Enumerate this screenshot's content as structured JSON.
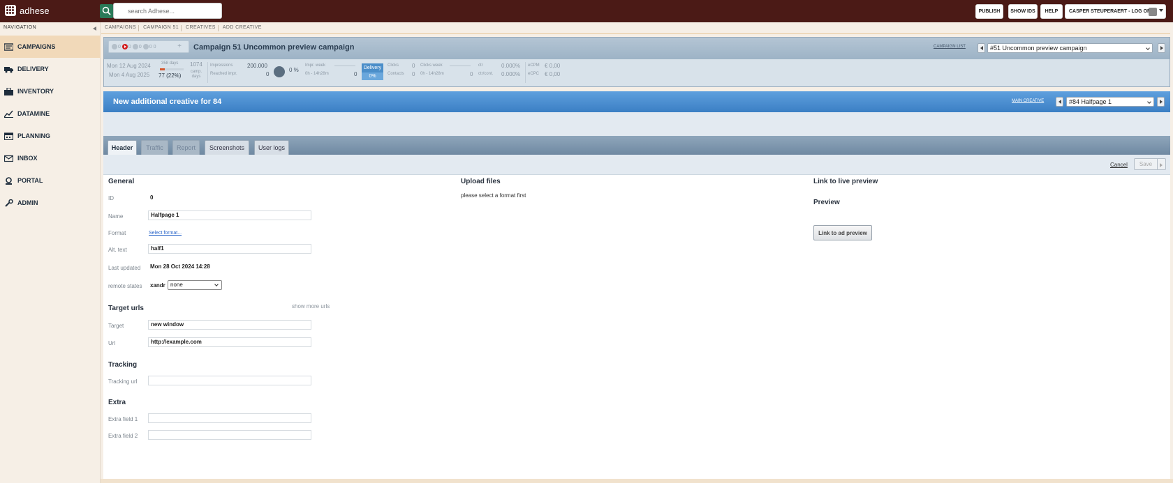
{
  "app": {
    "logo_text": "adhese"
  },
  "search": {
    "placeholder": "search Adhese..."
  },
  "topbar": {
    "publish": "PUBLISH",
    "show_ids": "SHOW IDS",
    "help": "HELP",
    "user": "CASPER STEUPERAERT - LOG OFF"
  },
  "sidebar": {
    "title": "NAVIGATION",
    "items": [
      {
        "label": "CAMPAIGNS",
        "icon": "campaigns-icon",
        "active": true
      },
      {
        "label": "DELIVERY",
        "icon": "truck-icon"
      },
      {
        "label": "INVENTORY",
        "icon": "briefcase-icon"
      },
      {
        "label": "DATAMINE",
        "icon": "chart-line-icon"
      },
      {
        "label": "PLANNING",
        "icon": "calendar-icon"
      },
      {
        "label": "INBOX",
        "icon": "envelope-icon"
      },
      {
        "label": "PORTAL",
        "icon": "portal-icon"
      },
      {
        "label": "ADMIN",
        "icon": "wrench-icon"
      }
    ]
  },
  "breadcrumb": [
    "CAMPAIGNS",
    "CAMPAIGN 51",
    "CREATIVES",
    "ADD CREATIVE"
  ],
  "campaign": {
    "status_counts": [
      "0",
      "0",
      "0",
      "0",
      "0"
    ],
    "title": "Campaign 51   Uncommon preview campaign",
    "list_link": "CAMPAIGN LIST",
    "select_value": "#51 Uncommon preview campaign",
    "start_date": "Mon 12 Aug 2024",
    "end_date": "Mon 4 Aug 2025",
    "days_total": "358 days",
    "days_done": "77 (22%)",
    "days_progress": 0.22,
    "camp_days_value": "1074",
    "camp_days_label": "camp. days",
    "impressions_label": "Impressions",
    "impressions_value": "200.000",
    "reached_label": "Reached impr.",
    "reached_value": "0",
    "gauge_pct": "0 %",
    "impr_week_label": "Impr. week",
    "impr_week_range": "0h - 14h28m",
    "impr_week_value": "0",
    "delivery_label": "Delivery",
    "delivery_pct": "0%",
    "clicks_label": "Clicks",
    "clicks_value": "0",
    "contacts_label": "Contacts",
    "contacts_value": "0",
    "clicks_week_label": "Clicks week",
    "clicks_week_range": "0h - 14h28m",
    "clicks_week_value": "0",
    "ctr_label": "ctr",
    "ctr_value": "0.000%",
    "ctr_cont_label": "ctr/cont.",
    "ctr_cont_value": "0.000%",
    "ecpm_label": "eCPM",
    "ecpm_value": "€ 0,00",
    "ecpc_label": "eCPC",
    "ecpc_value": "€ 0,00"
  },
  "creative": {
    "title": "New additional creative for 84",
    "main_link": "MAIN CREATIVE",
    "select_value": "#84 Halfpage 1"
  },
  "tabs": [
    "Header",
    "Traffic",
    "Report",
    "Screenshots",
    "User logs"
  ],
  "actions": {
    "cancel": "Cancel",
    "save": "Save"
  },
  "form": {
    "general_title": "General",
    "id_label": "ID",
    "id_value": "0",
    "name_label": "Name",
    "name_value": "Halfpage 1",
    "format_label": "Format",
    "format_link": "Select format...",
    "alt_label": "Alt. text",
    "alt_value": "half1",
    "updated_label": "Last updated",
    "updated_value": "Mon 28 Oct 2024 14:28",
    "remote_label": "remote states",
    "remote_name": "xandr",
    "remote_value": "none",
    "target_urls_title": "Target urls",
    "show_more": "show more urls",
    "target_label": "Target",
    "target_value": "new window",
    "url_label": "Url",
    "url_value": "http://example.com",
    "tracking_title": "Tracking",
    "tracking_label": "Tracking url",
    "tracking_value": "",
    "extra_title": "Extra",
    "extra1_label": "Extra field 1",
    "extra1_value": "",
    "extra2_label": "Extra field 2",
    "extra2_value": "",
    "upload_title": "Upload files",
    "upload_note": "please select a format first",
    "live_title": "Link to live preview",
    "preview_title": "Preview",
    "preview_button": "Link to ad preview"
  }
}
